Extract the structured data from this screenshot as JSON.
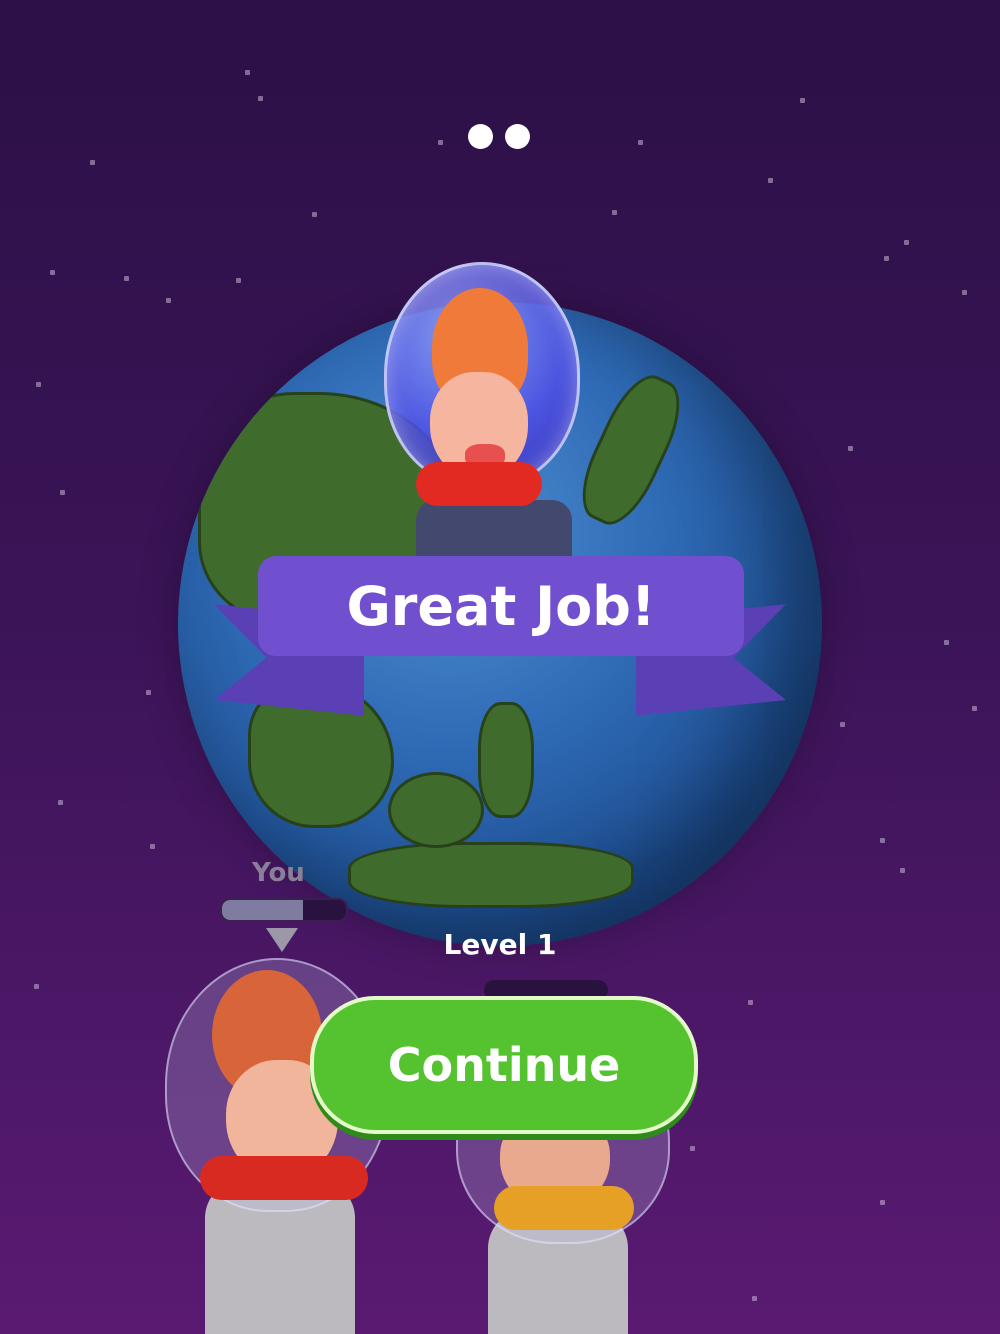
{
  "pager": {
    "dots": 2
  },
  "banner": {
    "title": "Great Job!"
  },
  "player": {
    "label": "You",
    "progress": 0.65
  },
  "level": {
    "label": "Level 1",
    "progress": 0.0
  },
  "actions": {
    "continue_label": "Continue"
  },
  "colors": {
    "background_top": "#2c1046",
    "background_bottom": "#5a1a72",
    "ribbon": "#7150d0",
    "button": "#55c22f"
  },
  "icons": [
    "down-triangle-icon"
  ]
}
